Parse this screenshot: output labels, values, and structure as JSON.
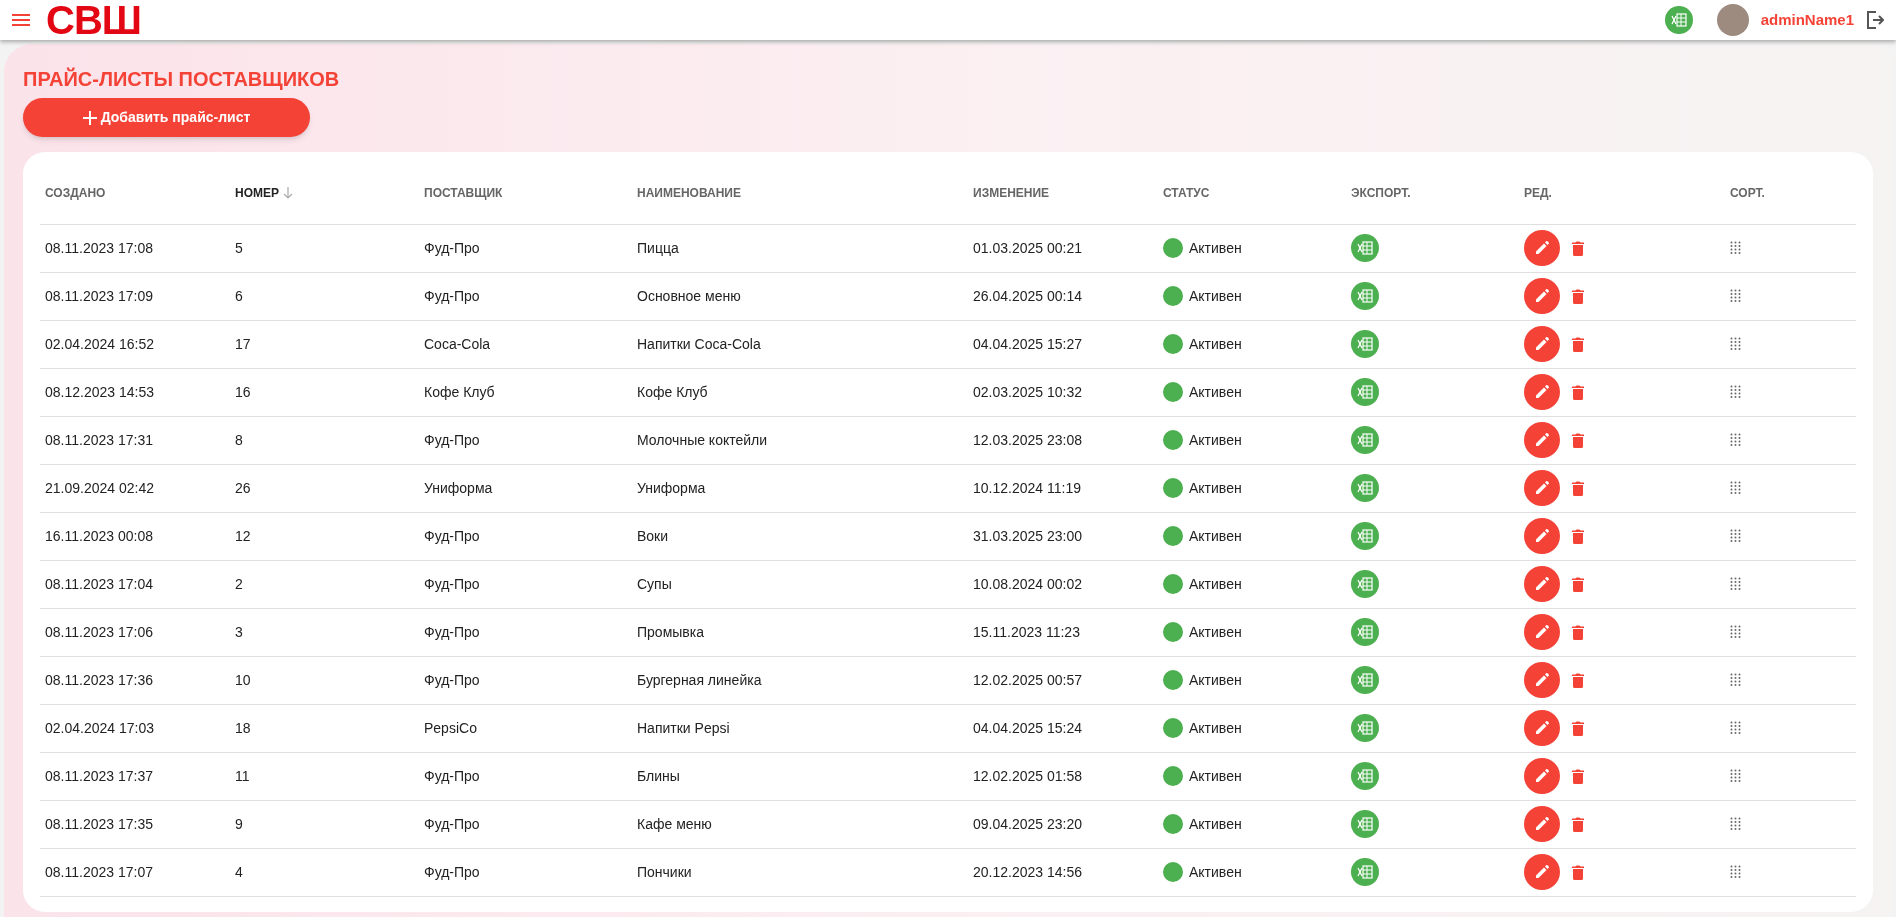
{
  "header": {
    "logo": "СВШ",
    "user": "adminName1"
  },
  "page": {
    "title": "ПРАЙС-ЛИСТЫ ПОСТАВЩИКОВ",
    "add_button": "Добавить прайс-лист"
  },
  "table": {
    "columns": [
      {
        "label": "СОЗДАНО",
        "sorted": false
      },
      {
        "label": "НОМЕР",
        "sorted": true
      },
      {
        "label": "ПОСТАВЩИК",
        "sorted": false
      },
      {
        "label": "НАИМЕНОВАНИЕ",
        "sorted": false
      },
      {
        "label": "ИЗМЕНЕНИЕ",
        "sorted": false
      },
      {
        "label": "СТАТУС",
        "sorted": false
      },
      {
        "label": "ЭКСПОРТ.",
        "sorted": false
      },
      {
        "label": "РЕД.",
        "sorted": false
      },
      {
        "label": "СОРТ.",
        "sorted": false
      }
    ],
    "rows": [
      {
        "created": "08.11.2023 17:08",
        "number": "5",
        "supplier": "Фуд-Про",
        "name": "Пицца",
        "modified": "01.03.2025 00:21",
        "status": "Активен",
        "active": true
      },
      {
        "created": "08.11.2023 17:09",
        "number": "6",
        "supplier": "Фуд-Про",
        "name": "Основное меню",
        "modified": "26.04.2025 00:14",
        "status": "Активен",
        "active": true
      },
      {
        "created": "02.04.2024 16:52",
        "number": "17",
        "supplier": "Coca-Cola",
        "name": "Напитки Coca-Cola",
        "modified": "04.04.2025 15:27",
        "status": "Активен",
        "active": true
      },
      {
        "created": "08.12.2023 14:53",
        "number": "16",
        "supplier": "Кофе Клуб",
        "name": "Кофе Клуб",
        "modified": "02.03.2025 10:32",
        "status": "Активен",
        "active": true
      },
      {
        "created": "08.11.2023 17:31",
        "number": "8",
        "supplier": "Фуд-Про",
        "name": "Молочные коктейли",
        "modified": "12.03.2025 23:08",
        "status": "Активен",
        "active": true
      },
      {
        "created": "21.09.2024 02:42",
        "number": "26",
        "supplier": "Униформа",
        "name": "Униформа",
        "modified": "10.12.2024 11:19",
        "status": "Активен",
        "active": true
      },
      {
        "created": "16.11.2023 00:08",
        "number": "12",
        "supplier": "Фуд-Про",
        "name": "Воки",
        "modified": "31.03.2025 23:00",
        "status": "Активен",
        "active": true
      },
      {
        "created": "08.11.2023 17:04",
        "number": "2",
        "supplier": "Фуд-Про",
        "name": "Супы",
        "modified": "10.08.2024 00:02",
        "status": "Активен",
        "active": true
      },
      {
        "created": "08.11.2023 17:06",
        "number": "3",
        "supplier": "Фуд-Про",
        "name": "Промывка",
        "modified": "15.11.2023 11:23",
        "status": "Активен",
        "active": true
      },
      {
        "created": "08.11.2023 17:36",
        "number": "10",
        "supplier": "Фуд-Про",
        "name": "Бургерная линейка",
        "modified": "12.02.2025 00:57",
        "status": "Активен",
        "active": true
      },
      {
        "created": "02.04.2024 17:03",
        "number": "18",
        "supplier": "PepsiCo",
        "name": "Напитки Pepsi",
        "modified": "04.04.2025 15:24",
        "status": "Активен",
        "active": true
      },
      {
        "created": "08.11.2023 17:37",
        "number": "11",
        "supplier": "Фуд-Про",
        "name": "Блины",
        "modified": "12.02.2025 01:58",
        "status": "Активен",
        "active": true
      },
      {
        "created": "08.11.2023 17:35",
        "number": "9",
        "supplier": "Фуд-Про",
        "name": "Кафе меню",
        "modified": "09.04.2025 23:20",
        "status": "Активен",
        "active": true
      },
      {
        "created": "08.11.2023 17:07",
        "number": "4",
        "supplier": "Фуд-Про",
        "name": "Пончики",
        "modified": "20.12.2023 14:56",
        "status": "Активен",
        "active": true
      }
    ]
  }
}
